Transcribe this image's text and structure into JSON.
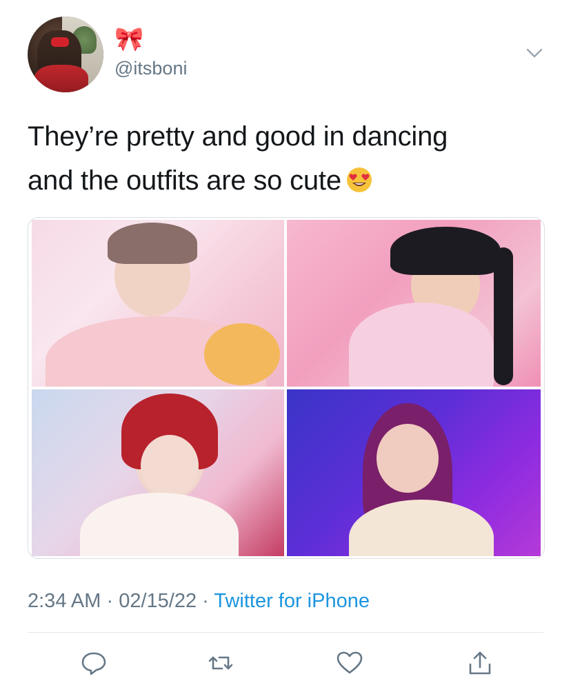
{
  "author": {
    "display_name_emoji": "🎀",
    "handle": "@itsboni"
  },
  "tweet": {
    "text_line1": "They’re pretty and good in dancing",
    "text_line2": "and the outfits are so cute",
    "emoji_icon": "heart-eyes-emoji"
  },
  "meta": {
    "time": "2:34 AM",
    "separator1": " · ",
    "date": "02/15/22",
    "separator2": " · ",
    "source": "Twitter for iPhone"
  },
  "colors": {
    "text": "#14171a",
    "secondary": "#657786",
    "link": "#1b95e0",
    "divider": "#e1e8ed"
  },
  "actions": [
    {
      "icon": "reply-icon"
    },
    {
      "icon": "retweet-icon"
    },
    {
      "icon": "like-icon"
    },
    {
      "icon": "share-icon"
    }
  ]
}
